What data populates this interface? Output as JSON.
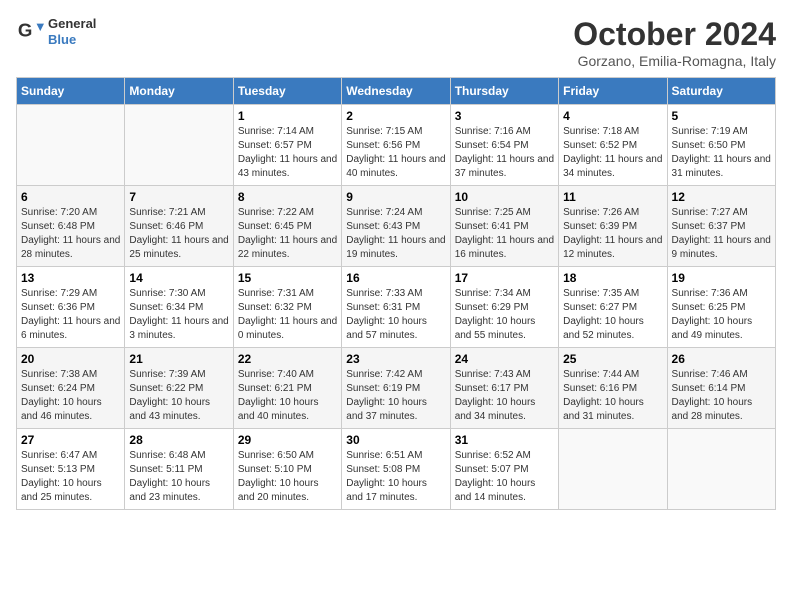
{
  "logo": {
    "text_general": "General",
    "text_blue": "Blue"
  },
  "title": "October 2024",
  "subtitle": "Gorzano, Emilia-Romagna, Italy",
  "headers": [
    "Sunday",
    "Monday",
    "Tuesday",
    "Wednesday",
    "Thursday",
    "Friday",
    "Saturday"
  ],
  "weeks": [
    [
      {
        "day": "",
        "info": ""
      },
      {
        "day": "",
        "info": ""
      },
      {
        "day": "1",
        "info": "Sunrise: 7:14 AM\nSunset: 6:57 PM\nDaylight: 11 hours and 43 minutes."
      },
      {
        "day": "2",
        "info": "Sunrise: 7:15 AM\nSunset: 6:56 PM\nDaylight: 11 hours and 40 minutes."
      },
      {
        "day": "3",
        "info": "Sunrise: 7:16 AM\nSunset: 6:54 PM\nDaylight: 11 hours and 37 minutes."
      },
      {
        "day": "4",
        "info": "Sunrise: 7:18 AM\nSunset: 6:52 PM\nDaylight: 11 hours and 34 minutes."
      },
      {
        "day": "5",
        "info": "Sunrise: 7:19 AM\nSunset: 6:50 PM\nDaylight: 11 hours and 31 minutes."
      }
    ],
    [
      {
        "day": "6",
        "info": "Sunrise: 7:20 AM\nSunset: 6:48 PM\nDaylight: 11 hours and 28 minutes."
      },
      {
        "day": "7",
        "info": "Sunrise: 7:21 AM\nSunset: 6:46 PM\nDaylight: 11 hours and 25 minutes."
      },
      {
        "day": "8",
        "info": "Sunrise: 7:22 AM\nSunset: 6:45 PM\nDaylight: 11 hours and 22 minutes."
      },
      {
        "day": "9",
        "info": "Sunrise: 7:24 AM\nSunset: 6:43 PM\nDaylight: 11 hours and 19 minutes."
      },
      {
        "day": "10",
        "info": "Sunrise: 7:25 AM\nSunset: 6:41 PM\nDaylight: 11 hours and 16 minutes."
      },
      {
        "day": "11",
        "info": "Sunrise: 7:26 AM\nSunset: 6:39 PM\nDaylight: 11 hours and 12 minutes."
      },
      {
        "day": "12",
        "info": "Sunrise: 7:27 AM\nSunset: 6:37 PM\nDaylight: 11 hours and 9 minutes."
      }
    ],
    [
      {
        "day": "13",
        "info": "Sunrise: 7:29 AM\nSunset: 6:36 PM\nDaylight: 11 hours and 6 minutes."
      },
      {
        "day": "14",
        "info": "Sunrise: 7:30 AM\nSunset: 6:34 PM\nDaylight: 11 hours and 3 minutes."
      },
      {
        "day": "15",
        "info": "Sunrise: 7:31 AM\nSunset: 6:32 PM\nDaylight: 11 hours and 0 minutes."
      },
      {
        "day": "16",
        "info": "Sunrise: 7:33 AM\nSunset: 6:31 PM\nDaylight: 10 hours and 57 minutes."
      },
      {
        "day": "17",
        "info": "Sunrise: 7:34 AM\nSunset: 6:29 PM\nDaylight: 10 hours and 55 minutes."
      },
      {
        "day": "18",
        "info": "Sunrise: 7:35 AM\nSunset: 6:27 PM\nDaylight: 10 hours and 52 minutes."
      },
      {
        "day": "19",
        "info": "Sunrise: 7:36 AM\nSunset: 6:25 PM\nDaylight: 10 hours and 49 minutes."
      }
    ],
    [
      {
        "day": "20",
        "info": "Sunrise: 7:38 AM\nSunset: 6:24 PM\nDaylight: 10 hours and 46 minutes."
      },
      {
        "day": "21",
        "info": "Sunrise: 7:39 AM\nSunset: 6:22 PM\nDaylight: 10 hours and 43 minutes."
      },
      {
        "day": "22",
        "info": "Sunrise: 7:40 AM\nSunset: 6:21 PM\nDaylight: 10 hours and 40 minutes."
      },
      {
        "day": "23",
        "info": "Sunrise: 7:42 AM\nSunset: 6:19 PM\nDaylight: 10 hours and 37 minutes."
      },
      {
        "day": "24",
        "info": "Sunrise: 7:43 AM\nSunset: 6:17 PM\nDaylight: 10 hours and 34 minutes."
      },
      {
        "day": "25",
        "info": "Sunrise: 7:44 AM\nSunset: 6:16 PM\nDaylight: 10 hours and 31 minutes."
      },
      {
        "day": "26",
        "info": "Sunrise: 7:46 AM\nSunset: 6:14 PM\nDaylight: 10 hours and 28 minutes."
      }
    ],
    [
      {
        "day": "27",
        "info": "Sunrise: 6:47 AM\nSunset: 5:13 PM\nDaylight: 10 hours and 25 minutes."
      },
      {
        "day": "28",
        "info": "Sunrise: 6:48 AM\nSunset: 5:11 PM\nDaylight: 10 hours and 23 minutes."
      },
      {
        "day": "29",
        "info": "Sunrise: 6:50 AM\nSunset: 5:10 PM\nDaylight: 10 hours and 20 minutes."
      },
      {
        "day": "30",
        "info": "Sunrise: 6:51 AM\nSunset: 5:08 PM\nDaylight: 10 hours and 17 minutes."
      },
      {
        "day": "31",
        "info": "Sunrise: 6:52 AM\nSunset: 5:07 PM\nDaylight: 10 hours and 14 minutes."
      },
      {
        "day": "",
        "info": ""
      },
      {
        "day": "",
        "info": ""
      }
    ]
  ]
}
